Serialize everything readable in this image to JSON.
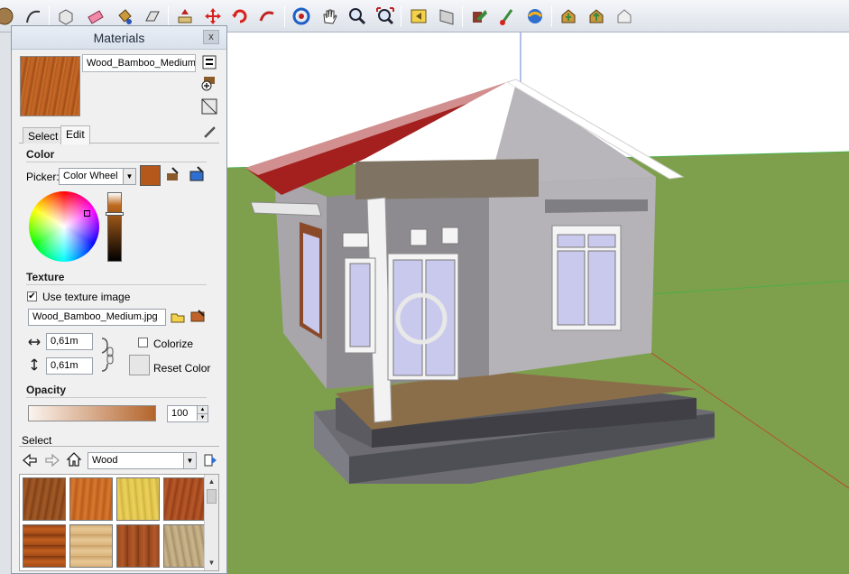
{
  "panel": {
    "title": "Materials",
    "close_label": "x",
    "material_name": "Wood_Bamboo_Medium",
    "tabs": [
      {
        "label": "Select"
      },
      {
        "label": "Edit"
      }
    ],
    "color": {
      "heading": "Color",
      "picker_label": "Picker:",
      "picker_value": "Color Wheel",
      "swatch_color": "#b5581b"
    },
    "texture": {
      "heading": "Texture",
      "use_texture_label": "Use texture image",
      "use_texture_checked": true,
      "file_name": "Wood_Bamboo_Medium.jpg",
      "width": "0,61m",
      "height": "0,61m",
      "colorize_label": "Colorize",
      "colorize_checked": false,
      "reset_label": "Reset Color"
    },
    "opacity": {
      "heading": "Opacity",
      "value": "100"
    },
    "select_section": {
      "heading": "Select",
      "library_value": "Wood"
    }
  },
  "colors": {
    "sky": "#ffffff",
    "ground": "#7ea04c",
    "roof": "#a3201f",
    "wall": "#a8a6ab",
    "panel_bg": "#f0f0f0",
    "accent_wood": "#b5581b"
  }
}
